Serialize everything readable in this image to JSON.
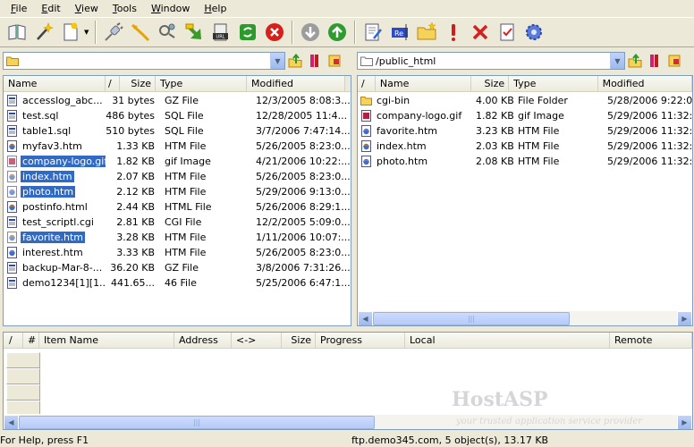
{
  "menu": [
    "File",
    "Edit",
    "View",
    "Tools",
    "Window",
    "Help"
  ],
  "toolbar_icons": [
    "book-icon",
    "magic-wand-icon",
    "new-file-icon",
    "connect-plug-icon",
    "disconnect-icon",
    "refresh-connection-icon",
    "download-arrow-icon",
    "url-icon",
    "sync-icon",
    "stop-icon",
    "down-circle-icon",
    "up-circle-icon",
    "edit-icon",
    "rename-icon",
    "new-folder-icon",
    "important-icon",
    "delete-icon",
    "properties-icon",
    "settings-gear-icon"
  ],
  "local": {
    "path": "",
    "columns": [
      "Name",
      "/",
      "Size",
      "Type",
      "Modified"
    ],
    "files": [
      {
        "name": "accesslog_abc...",
        "size": "31 bytes",
        "type": "GZ File",
        "modified": "12/3/2005 8:08:3...",
        "icon": "gz-file-icon",
        "selected": false
      },
      {
        "name": "test.sql",
        "size": "486 bytes",
        "type": "SQL File",
        "modified": "12/28/2005 11:4...",
        "icon": "sql-file-icon",
        "selected": false
      },
      {
        "name": "table1.sql",
        "size": "510 bytes",
        "type": "SQL File",
        "modified": "3/7/2006 7:47:14...",
        "icon": "sql-file-icon",
        "selected": false
      },
      {
        "name": "myfav3.htm",
        "size": "1.33 KB",
        "type": "HTM File",
        "modified": "5/26/2005 8:23:0...",
        "icon": "htm-file-icon",
        "selected": false
      },
      {
        "name": "company-logo.gif",
        "size": "1.82 KB",
        "type": "gif Image",
        "modified": "4/21/2006 10:22:...",
        "icon": "gif-file-icon",
        "selected": true
      },
      {
        "name": "index.htm",
        "size": "2.07 KB",
        "type": "HTM File",
        "modified": "5/26/2005 8:23:0...",
        "icon": "htm-file-icon",
        "selected": true
      },
      {
        "name": "photo.htm",
        "size": "2.12 KB",
        "type": "HTM File",
        "modified": "5/29/2006 9:13:0...",
        "icon": "htm-file-icon",
        "selected": true
      },
      {
        "name": "postinfo.html",
        "size": "2.44 KB",
        "type": "HTML File",
        "modified": "5/26/2006 8:29:1...",
        "icon": "htm-file-icon",
        "selected": false
      },
      {
        "name": "test_scriptl.cgi",
        "size": "2.81 KB",
        "type": "CGI File",
        "modified": "12/2/2005 5:09:0...",
        "icon": "cgi-file-icon",
        "selected": false
      },
      {
        "name": "favorite.htm",
        "size": "3.28 KB",
        "type": "HTM File",
        "modified": "1/11/2006 10:07:...",
        "icon": "htm-file-icon",
        "selected": true
      },
      {
        "name": "interest.htm",
        "size": "3.33 KB",
        "type": "HTM File",
        "modified": "5/26/2005 8:23:0...",
        "icon": "htm-file-icon",
        "selected": false
      },
      {
        "name": "backup-Mar-8-...",
        "size": "36.20 KB",
        "type": "GZ File",
        "modified": "3/8/2006 7:31:26...",
        "icon": "gz-file-icon",
        "selected": false
      },
      {
        "name": "demo1234[1][1...",
        "size": "441.65...",
        "type": "46 File",
        "modified": "5/25/2006 6:47:1...",
        "icon": "generic-file-icon",
        "selected": false
      }
    ]
  },
  "remote": {
    "path": "/public_html",
    "columns": [
      "/",
      "Name",
      "Size",
      "Type",
      "Modified"
    ],
    "files": [
      {
        "name": "cgi-bin",
        "size": "4.00 KB",
        "type": "File Folder",
        "modified": "5/28/2006 9:22:0...",
        "icon": "folder-icon"
      },
      {
        "name": "company-logo.gif",
        "size": "1.82 KB",
        "type": "gif Image",
        "modified": "5/29/2006 11:32:...",
        "icon": "gif-file-icon"
      },
      {
        "name": "favorite.htm",
        "size": "3.23 KB",
        "type": "HTM File",
        "modified": "5/29/2006 11:32:...",
        "icon": "htm-file-icon"
      },
      {
        "name": "index.htm",
        "size": "2.03 KB",
        "type": "HTM File",
        "modified": "5/29/2006 11:32:...",
        "icon": "htm-file-icon"
      },
      {
        "name": "photo.htm",
        "size": "2.08 KB",
        "type": "HTM File",
        "modified": "5/29/2006 11:32:...",
        "icon": "htm-file-icon"
      }
    ]
  },
  "queue": {
    "columns": [
      "/",
      "#",
      "Item Name",
      "Address",
      "<->",
      "Size",
      "Progress",
      "Local",
      "Remote"
    ]
  },
  "watermark": {
    "title": "HostASP",
    "subtitle": "your trusted application service provider"
  },
  "status": {
    "left": "For Help, press F1",
    "right": "ftp.demo345.com, 5 object(s), 13.17 KB"
  },
  "colors": {
    "selection": "#316ac5",
    "chrome": "#ece9d8"
  }
}
